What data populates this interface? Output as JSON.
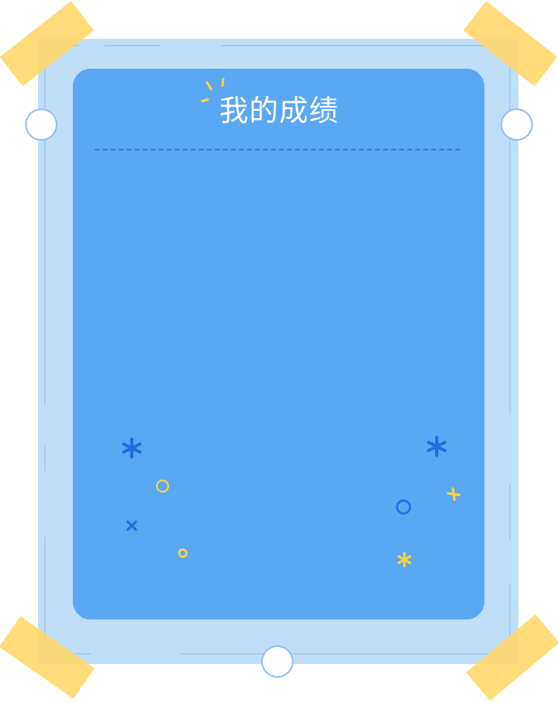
{
  "card": {
    "title": "我的成绩"
  },
  "colors": {
    "ticket": "#bfdff9",
    "card": "#5aa7f4",
    "tape": "#ffd76a",
    "accent_blue": "#1f6fe0",
    "accent_yellow": "#ffd43b"
  },
  "decorations": [
    "asterisk-icon",
    "circle-icon",
    "cross-icon",
    "plus-icon",
    "sparkle-icon"
  ]
}
